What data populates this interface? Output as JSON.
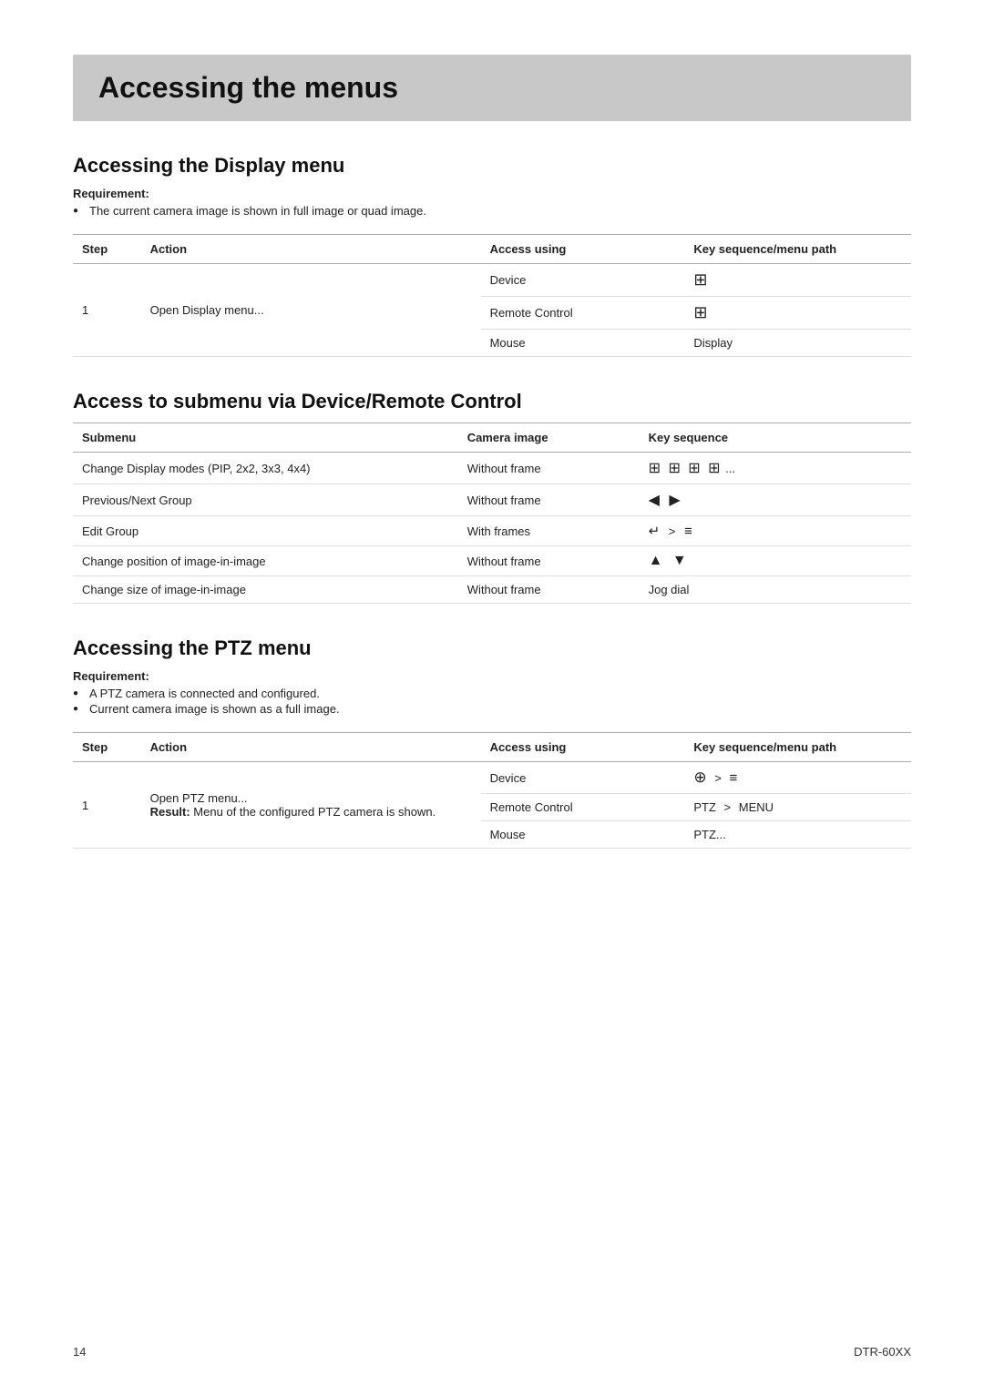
{
  "page": {
    "title": "Accessing the menus",
    "footer_page": "14",
    "footer_model": "DTR-60XX"
  },
  "display_menu": {
    "title": "Accessing the Display menu",
    "requirement_label": "Requirement:",
    "requirements": [
      "The current camera image is shown in full image or quad image."
    ],
    "table": {
      "headers": {
        "step": "Step",
        "action": "Action",
        "access_using": "Access using",
        "key_sequence": "Key sequence/menu path"
      },
      "rows": [
        {
          "step": "1",
          "action": "Open Display menu...",
          "access_rows": [
            {
              "access": "Device",
              "key": "⊞grid"
            },
            {
              "access": "Remote Control",
              "key": "⊞grid"
            },
            {
              "access": "Mouse",
              "key": "Display"
            }
          ]
        }
      ]
    }
  },
  "submenu_section": {
    "title": "Access to submenu via Device/Remote Control",
    "table": {
      "headers": {
        "submenu": "Submenu",
        "camera_image": "Camera image",
        "key_sequence": "Key sequence"
      },
      "rows": [
        {
          "submenu": "Change Display modes (PIP, 2x2, 3x3, 4x4)",
          "camera_image": "Without frame",
          "key_sequence": "⊞ ⊞ ⊞ ⊞ ..."
        },
        {
          "submenu": "Previous/Next Group",
          "camera_image": "Without frame",
          "key_sequence": "◀ ▶"
        },
        {
          "submenu": "Edit Group",
          "camera_image": "With frames",
          "key_sequence": "↵  >  ≡"
        },
        {
          "submenu": "Change position of image-in-image",
          "camera_image": "Without frame",
          "key_sequence": "▲ ▼"
        },
        {
          "submenu": "Change size of image-in-image",
          "camera_image": "Without frame",
          "key_sequence": "Jog dial"
        }
      ]
    }
  },
  "ptz_menu": {
    "title": "Accessing the PTZ menu",
    "requirement_label": "Requirement:",
    "requirements": [
      "A PTZ camera is connected and configured.",
      "Current camera image is shown as a full image."
    ],
    "table": {
      "headers": {
        "step": "Step",
        "action": "Action",
        "access_using": "Access using",
        "key_sequence": "Key sequence/menu path"
      },
      "rows": [
        {
          "step": "1",
          "action_main": "Open PTZ menu...",
          "action_result_label": "Result:",
          "action_result": "Menu of the configured PTZ camera is shown.",
          "access_rows": [
            {
              "access": "Device",
              "key": "⊕  >  ≡"
            },
            {
              "access": "Remote Control",
              "key": "PTZ  >  MENU"
            },
            {
              "access": "Mouse",
              "key": "PTZ..."
            }
          ]
        }
      ]
    }
  }
}
